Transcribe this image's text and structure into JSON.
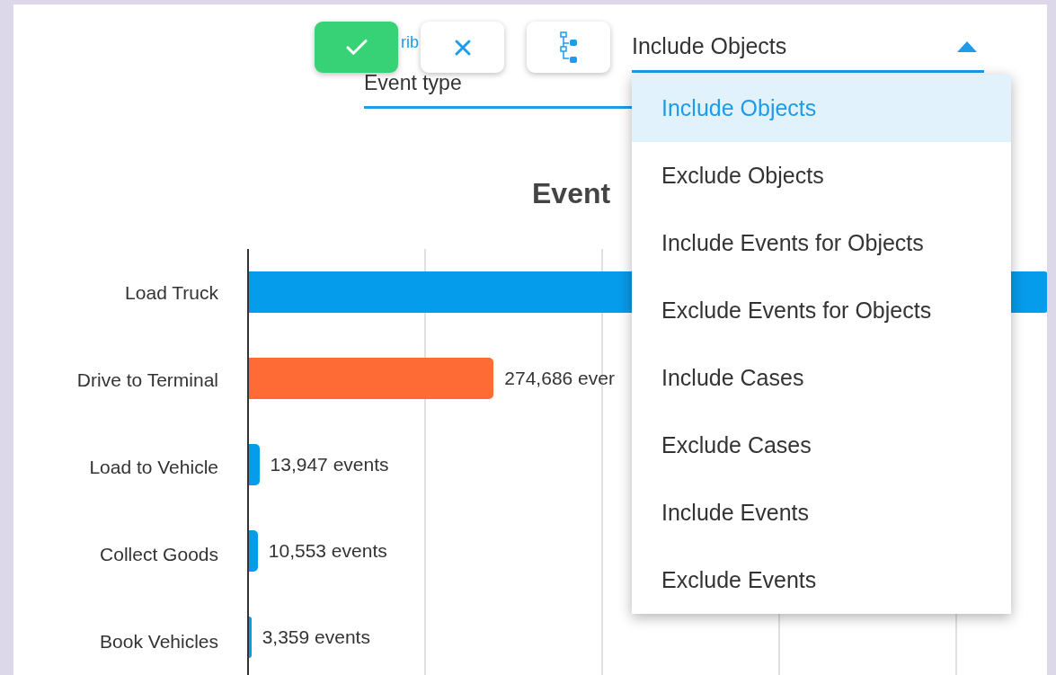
{
  "toolbar": {
    "buttons": [
      {
        "kind": "confirm"
      },
      {
        "kind": "cancel"
      },
      {
        "kind": "flow"
      }
    ]
  },
  "event_field": {
    "label": "rib",
    "value": "Event type"
  },
  "mode_select": {
    "value": "Include Objects",
    "expanded": true,
    "options": [
      {
        "label": "Include Objects",
        "selected": true
      },
      {
        "label": "Exclude Objects",
        "selected": false
      },
      {
        "label": "Include Events for Objects",
        "selected": false
      },
      {
        "label": "Exclude Events for Objects",
        "selected": false
      },
      {
        "label": "Include Cases",
        "selected": false
      },
      {
        "label": "Exclude Cases",
        "selected": false
      },
      {
        "label": "Include Events",
        "selected": false
      },
      {
        "label": "Exclude Events",
        "selected": false
      }
    ]
  },
  "chart": {
    "title": "Event",
    "bars": [
      {
        "label": "Load Truck",
        "level": 1,
        "color": "#069cec"
      },
      {
        "label": "Drive to Terminal",
        "count": "274,686 ever",
        "level": 0.306,
        "color": "#fe6b35"
      },
      {
        "label": "Load to Vehicle",
        "count": "13,947 events",
        "level": 0.013,
        "color": "#069cec"
      },
      {
        "label": "Collect Goods",
        "count": "10,553 events",
        "level": 0.011,
        "color": "#069cec"
      },
      {
        "label": "Book Vehicles",
        "count": "3,359 events",
        "level": 0.003,
        "color": "#069cec"
      }
    ]
  }
}
